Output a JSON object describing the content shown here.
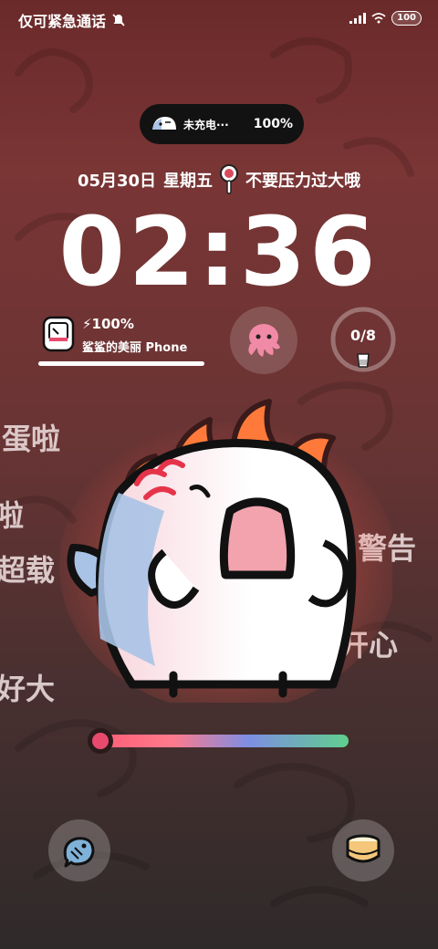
{
  "status_bar": {
    "left_text": "仅可紧急通话",
    "battery": "100"
  },
  "charge_pill": {
    "label": "未充电···",
    "percent": "100%"
  },
  "date_line": {
    "date": "05月30日",
    "weekday": "星期五",
    "message": "不要压力过大哦"
  },
  "clock": {
    "time": "02:36"
  },
  "device_card": {
    "percent": "100%",
    "name": "鲨鲨的美丽 Phone",
    "level": 1.0
  },
  "water_widget": {
    "count": "0/8"
  },
  "side_texts": [
    "蛋啦",
    "啦",
    "超载",
    "好大",
    "警告",
    "开心"
  ],
  "slider": {
    "level": 0.0
  },
  "colors": {
    "accent_pink": "#ff5d76",
    "mascot_blue": "#a9c3e6"
  },
  "icons": {
    "left_button": "fish-icon",
    "right_button": "pudding-icon",
    "octopus": "octopus-icon"
  }
}
